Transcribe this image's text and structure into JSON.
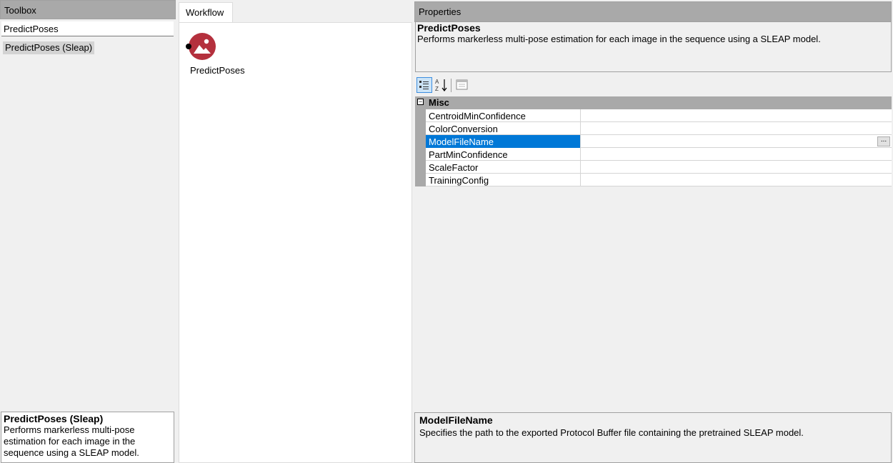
{
  "toolbox": {
    "title": "Toolbox",
    "search_value": "PredictPoses",
    "result_item": "PredictPoses (Sleap)",
    "description": {
      "title": "PredictPoses (Sleap)",
      "line1": "Performs markerless multi-pose",
      "line2": "estimation for each image in the",
      "line3": "sequence using a SLEAP model."
    }
  },
  "workflow": {
    "tab_label": "Workflow",
    "node": {
      "label": "PredictPoses",
      "icon": "image-icon",
      "color": "#b4303d"
    }
  },
  "properties": {
    "title": "Properties",
    "summary": {
      "title": "PredictPoses",
      "text": "Performs markerless multi-pose estimation for each image in the sequence using a SLEAP model."
    },
    "toolbar": {
      "categorized_icon": "categorized-icon",
      "alphabetical_icon": "sort-alphabetical-icon",
      "property_pages_icon": "property-pages-icon"
    },
    "category": {
      "toggle": "⊟",
      "label": "Misc"
    },
    "rows": [
      {
        "name": "CentroidMinConfidence",
        "value": ""
      },
      {
        "name": "ColorConversion",
        "value": ""
      },
      {
        "name": "ModelFileName",
        "value": "",
        "button": "..."
      },
      {
        "name": "PartMinConfidence",
        "value": ""
      },
      {
        "name": "ScaleFactor",
        "value": ""
      },
      {
        "name": "TrainingConfig",
        "value": ""
      }
    ],
    "selected_row": 2,
    "description": {
      "title": "ModelFileName",
      "text": "Specifies the path to the exported Protocol Buffer file containing the pretrained SLEAP model."
    }
  },
  "colors": {
    "selection": "#0078d7",
    "header": "#a9a9a9",
    "node": "#b4303d"
  }
}
